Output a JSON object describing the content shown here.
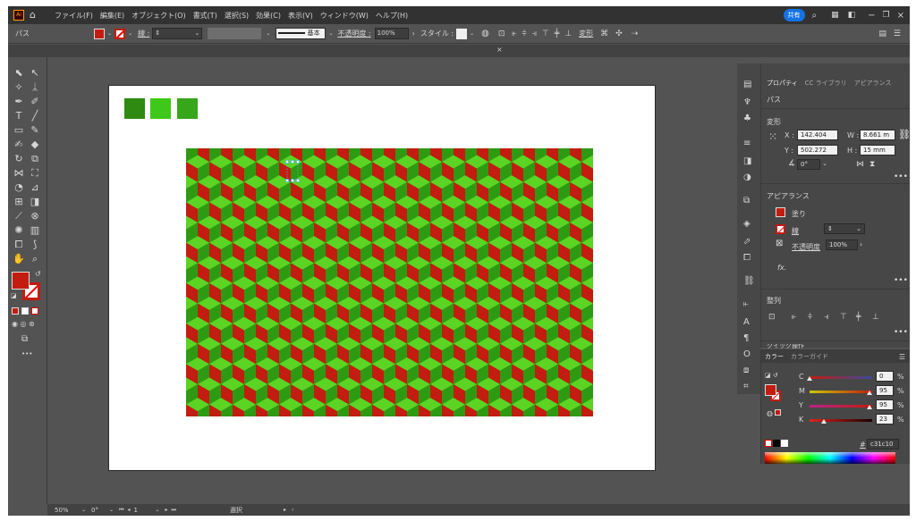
{
  "menubar": {
    "app_icon": "illustrator-app-icon",
    "items": [
      "ファイル(F)",
      "編集(E)",
      "オブジェクト(O)",
      "書式(T)",
      "選択(S)",
      "効果(C)",
      "表示(V)",
      "ウィンドウ(W)",
      "ヘルプ(H)"
    ],
    "share_label": "共有"
  },
  "control_bar": {
    "object_type": "パス",
    "stroke_label": "線 :",
    "brush_label": "基本",
    "opacity_label": "不透明度 :",
    "opacity_value": "100%",
    "style_label": "スタイル :",
    "transform_label": "変形"
  },
  "doc_tab": {
    "close_glyph": "×"
  },
  "status": {
    "zoom": "50%",
    "rotation": "0°",
    "artboard_number": "1",
    "mode": "選択"
  },
  "colors": {
    "swatch_dark": "#2e8a10",
    "swatch_bright": "#3ec81a",
    "swatch_mid": "#36a61a",
    "pattern_red": "#c31c10",
    "pattern_light": "#5bd424",
    "pattern_dark": "#2e9a12",
    "fill_color": "#c31c10"
  },
  "properties_panel": {
    "tabs": [
      "プロパティ",
      "CC ライブラリ",
      "アピアランス"
    ],
    "object_type": "パス",
    "transform": {
      "title": "変形",
      "x_label": "X :",
      "x_value": "142.404",
      "y_label": "Y :",
      "y_value": "502.272",
      "w_label": "W :",
      "w_value": "8.661 m",
      "h_label": "H :",
      "h_value": "15 mm",
      "angle_value": "0°"
    },
    "appearance": {
      "title": "アピアランス",
      "fill_label": "塗り",
      "stroke_label": "線",
      "opacity_label": "不透明度",
      "opacity_value": "100%",
      "fx_label": "fx."
    },
    "align": {
      "title": "整列"
    },
    "quick_actions_title": "クイック操作"
  },
  "color_panel": {
    "tabs": [
      "カラー",
      "カラーガイド"
    ],
    "c_label": "C",
    "c_value": "0",
    "c_level": 0.0,
    "m_label": "M",
    "m_value": "95",
    "m_level": 0.95,
    "y_label": "Y",
    "y_value": "95",
    "y_level": 0.95,
    "k_label": "K",
    "k_value": "23",
    "k_level": 0.23,
    "percent": "%",
    "hex_prefix": "#",
    "hex_value": "c31c10"
  },
  "more_glyph": "•••"
}
